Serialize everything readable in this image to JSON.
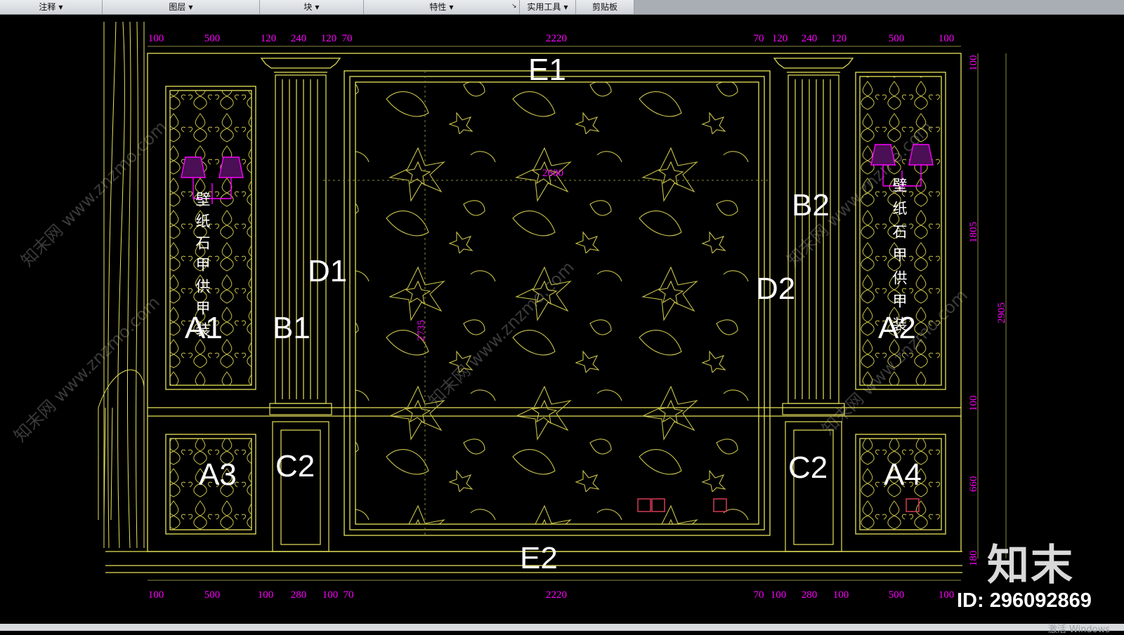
{
  "ribbon": {
    "tabs": [
      {
        "label": "注释"
      },
      {
        "label": "图层"
      },
      {
        "label": "块"
      },
      {
        "label": "特性"
      },
      {
        "label": "实用工具"
      },
      {
        "label": "剪贴板"
      }
    ]
  },
  "drawing": {
    "top_dims": [
      "100",
      "500",
      "120",
      "240",
      "120",
      "70",
      "2220",
      "70",
      "120",
      "240",
      "120",
      "500",
      "100"
    ],
    "bottom_dims": [
      "100",
      "500",
      "100",
      "280",
      "100",
      "70",
      "2220",
      "70",
      "100",
      "280",
      "100",
      "500",
      "100"
    ],
    "inner_width_dim": "2600",
    "inner_height_dim": "2735",
    "right_dims": [
      "100",
      "1805",
      "100",
      "660",
      "180"
    ],
    "total_height_dim": "2905",
    "labels": {
      "a1": "A1",
      "a2": "A2",
      "a3": "A3",
      "a4": "A4",
      "b1": "B1",
      "b2": "B2",
      "c2_left": "C2",
      "c2_right": "C2",
      "d1": "D1",
      "d2": "D2",
      "e1": "E1",
      "e2": "E2"
    },
    "wallpaper_note": "壁纸石甲供甲装",
    "watermark": "知末网 www.znzmo.com"
  },
  "brand": {
    "logo": "知末",
    "id": "ID: 296092869"
  },
  "status": {
    "text": "激活 Windows"
  },
  "colors": {
    "dim": "#ff00ff",
    "line": "#e8e35a",
    "background": "#000000",
    "label": "#ffffff"
  }
}
